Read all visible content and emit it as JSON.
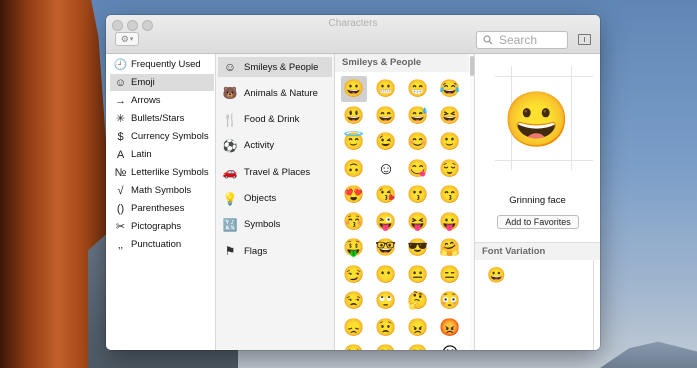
{
  "window": {
    "title": "Characters",
    "search_placeholder": "Search"
  },
  "categories": [
    {
      "label": "Frequently Used",
      "icon": "clock-icon",
      "glyph": "🕘"
    },
    {
      "label": "Emoji",
      "icon": "smiley-icon",
      "glyph": "☺",
      "selected": true
    },
    {
      "label": "Arrows",
      "icon": "arrow-icon",
      "glyph": "→"
    },
    {
      "label": "Bullets/Stars",
      "icon": "asterisk-icon",
      "glyph": "✳"
    },
    {
      "label": "Currency Symbols",
      "icon": "dollar-icon",
      "glyph": "$"
    },
    {
      "label": "Latin",
      "icon": "latin-a-icon",
      "glyph": "A"
    },
    {
      "label": "Letterlike Symbols",
      "icon": "numero-icon",
      "glyph": "№"
    },
    {
      "label": "Math Symbols",
      "icon": "sqrt-icon",
      "glyph": "√"
    },
    {
      "label": "Parentheses",
      "icon": "parentheses-icon",
      "glyph": "()"
    },
    {
      "label": "Pictographs",
      "icon": "pictograph-icon",
      "glyph": "✂"
    },
    {
      "label": "Punctuation",
      "icon": "punctuation-icon",
      "glyph": "‚‚"
    }
  ],
  "subcategories": [
    {
      "label": "Smileys & People",
      "icon": "smiley-icon",
      "glyph": "☺",
      "selected": true
    },
    {
      "label": "Animals & Nature",
      "icon": "paw-icon",
      "glyph": "🐻"
    },
    {
      "label": "Food & Drink",
      "icon": "food-icon",
      "glyph": "🍴"
    },
    {
      "label": "Activity",
      "icon": "ball-icon",
      "glyph": "⚽"
    },
    {
      "label": "Travel & Places",
      "icon": "car-icon",
      "glyph": "🚗"
    },
    {
      "label": "Objects",
      "icon": "bulb-icon",
      "glyph": "💡"
    },
    {
      "label": "Symbols",
      "icon": "symbols-icon",
      "glyph": "🔣"
    },
    {
      "label": "Flags",
      "icon": "flag-icon",
      "glyph": "⚑"
    }
  ],
  "grid": {
    "header": "Smileys & People",
    "rows": [
      [
        "😀",
        "😬",
        "😁",
        "😂"
      ],
      [
        "😃",
        "😄",
        "😅",
        "😆"
      ],
      [
        "😇",
        "😉",
        "😊",
        "🙂"
      ],
      [
        "🙃",
        "☺",
        "😋",
        "😌"
      ],
      [
        "😍",
        "😘",
        "😗",
        "😙"
      ],
      [
        "😚",
        "😜",
        "😝",
        "😛"
      ],
      [
        "🤑",
        "🤓",
        "😎",
        "🤗"
      ],
      [
        "😏",
        "😶",
        "😐",
        "😑"
      ],
      [
        "😒",
        "🙄",
        "🤔",
        "😳"
      ],
      [
        "😞",
        "😟",
        "😠",
        "😡"
      ],
      [
        "😔",
        "😕",
        "🙁",
        "☹"
      ]
    ],
    "selected_index": 0
  },
  "detail": {
    "preview_glyph": "😀",
    "name": "Grinning face",
    "add_button": "Add to Favorites",
    "font_variation_header": "Font Variation",
    "variation_glyph": "😀"
  }
}
